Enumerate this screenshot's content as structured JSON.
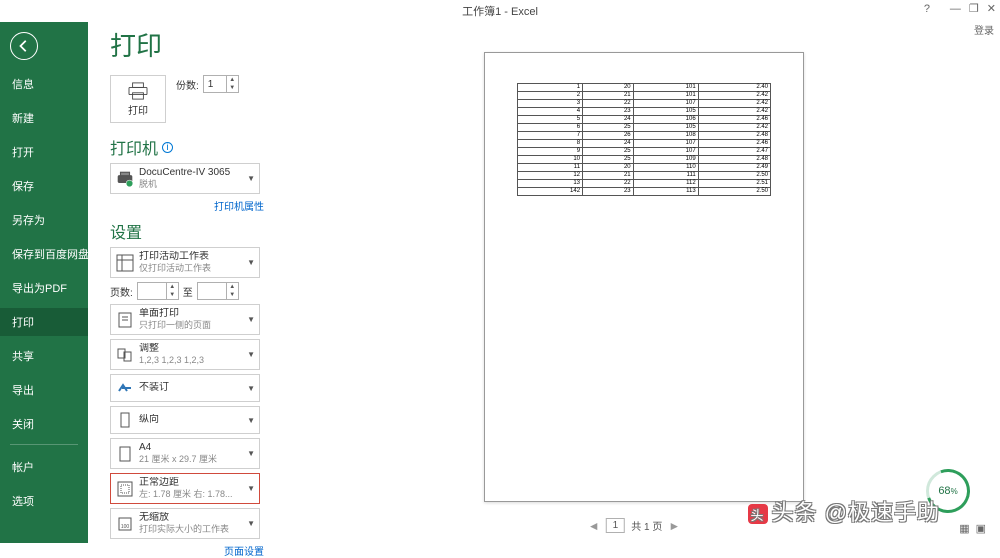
{
  "titlebar": {
    "title": "工作簿1 - Excel",
    "login": "登录"
  },
  "sidebar": {
    "items": [
      "信息",
      "新建",
      "打开",
      "保存",
      "另存为",
      "保存到百度网盘",
      "导出为PDF",
      "打印",
      "共享",
      "导出",
      "关闭"
    ],
    "bottom": [
      "帐户",
      "选项"
    ],
    "active_index": 7
  },
  "page": {
    "title": "打印"
  },
  "print_button": {
    "label": "打印"
  },
  "copies": {
    "label": "份数:",
    "value": "1"
  },
  "printer": {
    "header": "打印机",
    "name": "DocuCentre-IV 3065",
    "status": "脱机",
    "props_link": "打印机属性"
  },
  "settings": {
    "header": "设置",
    "items": [
      {
        "l1": "打印活动工作表",
        "l2": "仅打印活动工作表"
      }
    ],
    "pages": {
      "label": "页数:",
      "to": "至"
    },
    "more": [
      {
        "l1": "单面打印",
        "l2": "只打印一侧的页面"
      },
      {
        "l1": "调整",
        "l2": "1,2,3   1,2,3   1,2,3"
      },
      {
        "l1": "不装订",
        "l2": ""
      },
      {
        "l1": "纵向",
        "l2": ""
      },
      {
        "l1": "A4",
        "l2": "21 厘米 x 29.7 厘米"
      },
      {
        "l1": "正常边距",
        "l2": "左: 1.78 厘米  右: 1.78...",
        "highlight": true
      },
      {
        "l1": "无缩放",
        "l2": "打印实际大小的工作表"
      }
    ],
    "page_setup_link": "页面设置"
  },
  "preview_table": [
    [
      "1",
      "20",
      "101",
      "2.40"
    ],
    [
      "2",
      "21",
      "101",
      "2.42"
    ],
    [
      "3",
      "22",
      "107",
      "2.42"
    ],
    [
      "4",
      "23",
      "105",
      "2.42"
    ],
    [
      "5",
      "24",
      "106",
      "2.46"
    ],
    [
      "6",
      "25",
      "105",
      "2.42"
    ],
    [
      "7",
      "26",
      "108",
      "2.48"
    ],
    [
      "8",
      "24",
      "107",
      "2.46"
    ],
    [
      "9",
      "25",
      "107",
      "2.47"
    ],
    [
      "10",
      "25",
      "109",
      "2.48"
    ],
    [
      "11",
      "20",
      "110",
      "2.49"
    ],
    [
      "12",
      "21",
      "111",
      "2.50"
    ],
    [
      "13",
      "22",
      "112",
      "2.51"
    ],
    [
      "142",
      "23",
      "113",
      "2.50"
    ]
  ],
  "pager": {
    "current": "1",
    "total": "共 1 页"
  },
  "progress": {
    "value": "68",
    "unit": "%"
  },
  "watermark": "头条 @极速手助"
}
